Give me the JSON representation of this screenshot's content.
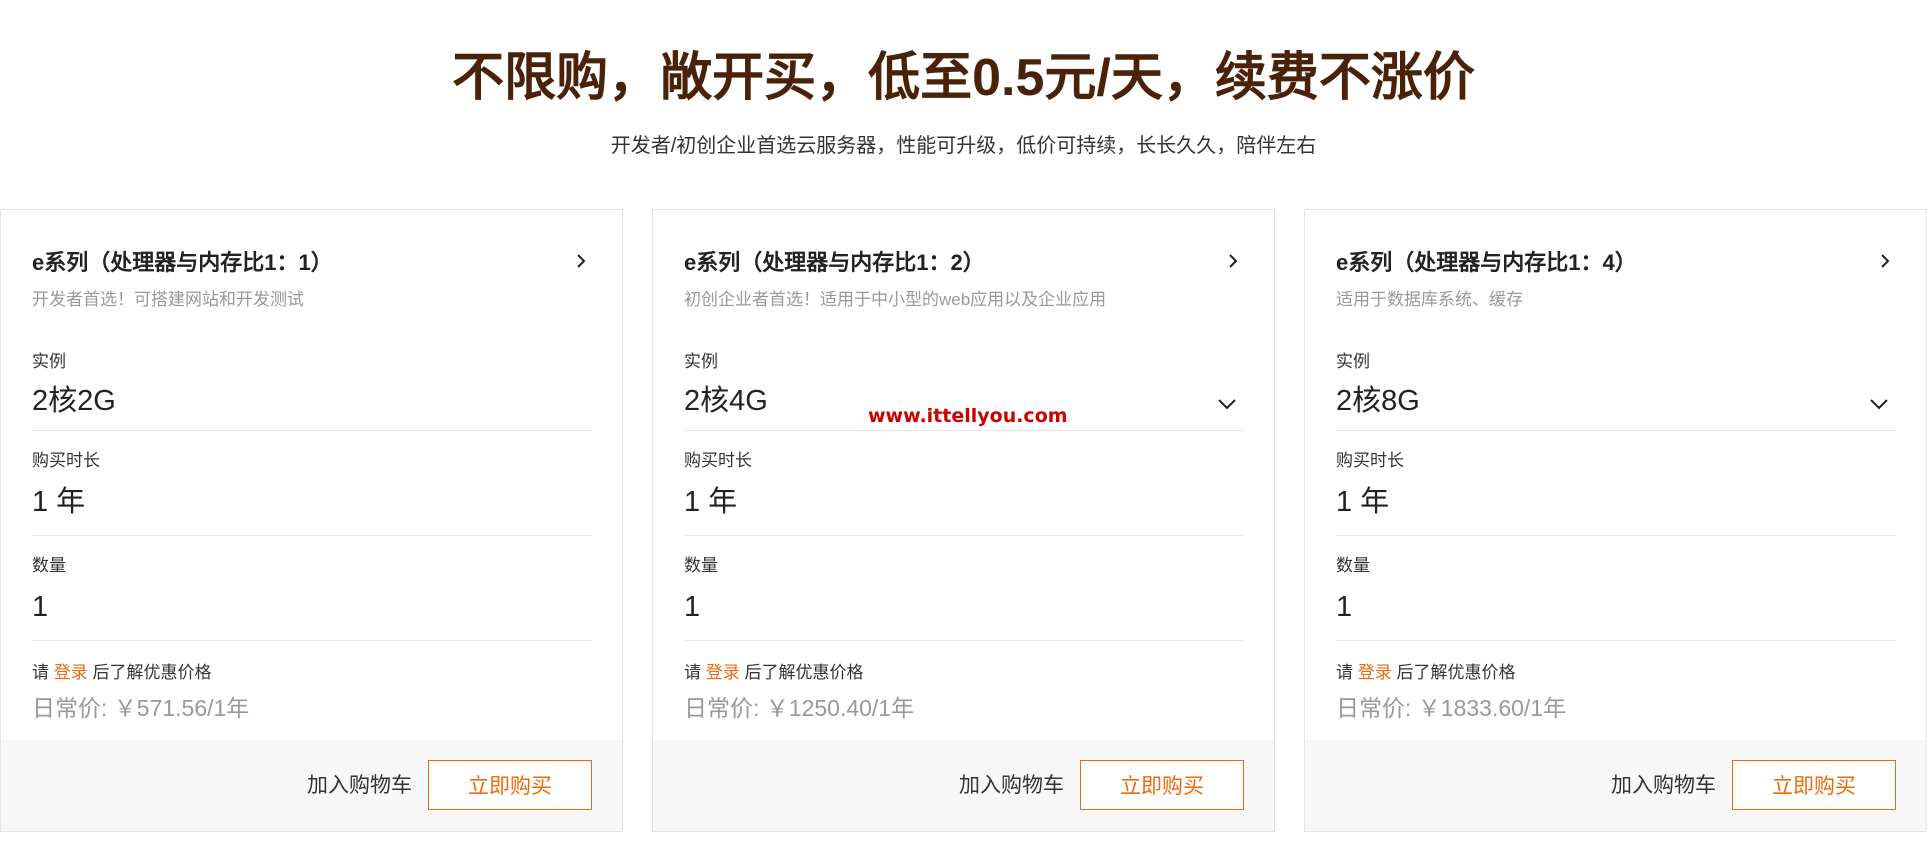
{
  "hero": {
    "title": "不限购，敞开买，低至0.5元/天，续费不涨价",
    "subtitle": "开发者/初创企业首选云服务器，性能可升级，低价可持续，长长久久，陪伴左右"
  },
  "colors": {
    "title": "#4a2209",
    "accent": "#ed6a0c",
    "watermark": "#cc0000"
  },
  "cards": [
    {
      "title": "e系列（处理器与内存比1：1）",
      "description": "开发者首选！可搭建网站和开发测试",
      "instance_label": "实例",
      "instance_value": "2核2G",
      "duration_label": "购买时长",
      "duration_value": "1 年",
      "quantity_label": "数量",
      "quantity_value": "1",
      "hint_prefix": "请 ",
      "login_label": "登录",
      "hint_suffix": " 后了解优惠价格",
      "regular_price": "日常价: ￥571.56/1年",
      "cart_label": "加入购物车",
      "buy_label": "立即购买"
    },
    {
      "title": "e系列（处理器与内存比1：2）",
      "description": "初创企业者首选！适用于中小型的web应用以及企业应用",
      "instance_label": "实例",
      "instance_value": "2核4G",
      "duration_label": "购买时长",
      "duration_value": "1 年",
      "quantity_label": "数量",
      "quantity_value": "1",
      "hint_prefix": "请 ",
      "login_label": "登录",
      "hint_suffix": " 后了解优惠价格",
      "regular_price": "日常价: ￥1250.40/1年",
      "cart_label": "加入购物车",
      "buy_label": "立即购买"
    },
    {
      "title": "e系列（处理器与内存比1：4）",
      "description": "适用于数据库系统、缓存",
      "instance_label": "实例",
      "instance_value": "2核8G",
      "duration_label": "购买时长",
      "duration_value": "1 年",
      "quantity_label": "数量",
      "quantity_value": "1",
      "hint_prefix": "请 ",
      "login_label": "登录",
      "hint_suffix": " 后了解优惠价格",
      "regular_price": "日常价: ￥1833.60/1年",
      "cart_label": "加入购物车",
      "buy_label": "立即购买"
    }
  ],
  "watermark": "www.ittellyou.com",
  "icons": {
    "card_link": "chevron-right-icon",
    "instance_dropdown": "chevron-down-icon"
  }
}
